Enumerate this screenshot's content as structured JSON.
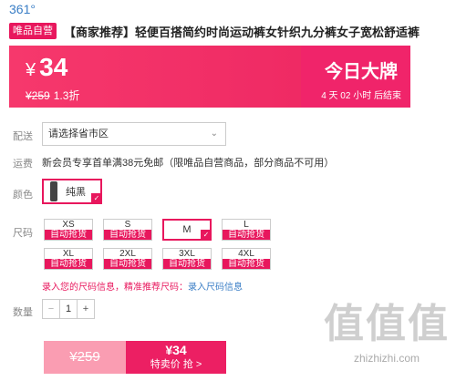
{
  "brand": "361°",
  "title_bar": {
    "badge": "唯品自营",
    "title": "【商家推荐】轻便百搭简约时尚运动裤女针织九分裤女子宽松舒适裤"
  },
  "price": {
    "yen": "¥",
    "current": "34",
    "original": "¥259",
    "discount": "1.3折",
    "deal_title": "今日大牌",
    "countdown": "4 天 02 小时 后结束"
  },
  "labels": {
    "delivery": "配送",
    "shipping": "运费",
    "color": "颜色",
    "size": "尺码",
    "quantity": "数量"
  },
  "delivery": {
    "value": "请选择省市区",
    "chevron": "⌄"
  },
  "shipping_text": "新会员专享首单满38元免邮（限唯品自营商品，部分商品不可用）",
  "color": {
    "value": "纯黑"
  },
  "sizes": [
    {
      "name": "XS",
      "tag": "自动抢货"
    },
    {
      "name": "S",
      "tag": "自动抢货"
    },
    {
      "name": "M",
      "tag": ""
    },
    {
      "name": "L",
      "tag": "自动抢货"
    },
    {
      "name": "XL",
      "tag": "自动抢货"
    },
    {
      "name": "2XL",
      "tag": "自动抢货"
    },
    {
      "name": "3XL",
      "tag": "自动抢货"
    },
    {
      "name": "4XL",
      "tag": "自动抢货"
    }
  ],
  "selected_size": "M",
  "size_info": {
    "prefix": "录入您的尺码信息，精准推荐尺码：",
    "link": "录入尺码信息"
  },
  "quantity": {
    "minus": "−",
    "value": "1",
    "plus": "+"
  },
  "cart": {
    "original": "¥259",
    "price": "¥34",
    "action": "特卖价 抢 >"
  },
  "watermark": {
    "glyphs": "值值值",
    "site": "zhizhizhi.com"
  },
  "colors": {
    "accent": "#e8175d",
    "link": "#3a7ec6"
  }
}
